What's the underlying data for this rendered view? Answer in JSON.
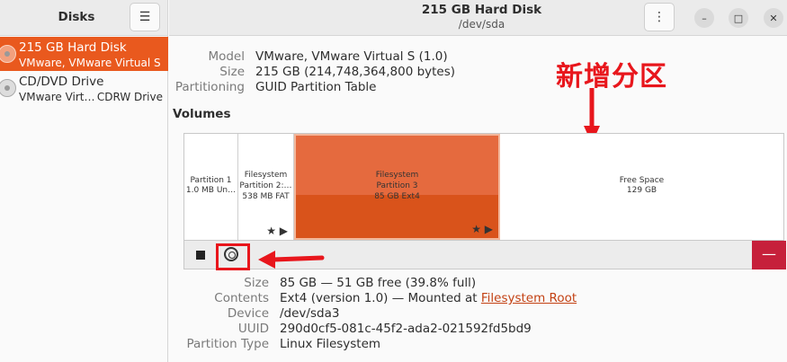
{
  "sidebar": {
    "title": "Disks",
    "menu_icon": "hamburger-icon",
    "disks": [
      {
        "name": "215 GB Hard Disk",
        "sub": "VMware, VMware Virtual S",
        "sub2": ""
      },
      {
        "name": "CD/DVD Drive",
        "sub": "VMware Virt…",
        "sub2": "CDRW Drive"
      }
    ]
  },
  "header": {
    "title": "215 GB Hard Disk",
    "subtitle": "/dev/sda",
    "kebab_icon": "⋮",
    "minimize_icon": "–",
    "maximize_icon": "□",
    "close_icon": "✕"
  },
  "disk_info": {
    "model_label": "Model",
    "model": "VMware, VMware Virtual S (1.0)",
    "size_label": "Size",
    "size": "215 GB (214,748,364,800 bytes)",
    "partitioning_label": "Partitioning",
    "partitioning": "GUID Partition Table"
  },
  "volumes": {
    "title": "Volumes",
    "segments": [
      {
        "l1": "Partition 1",
        "l2": "1.0 MB Un…",
        "l3": ""
      },
      {
        "l1": "Filesystem",
        "l2": "Partition 2:…",
        "l3": "538 MB FAT"
      },
      {
        "l1": "Filesystem",
        "l2": "Partition 3",
        "l3": "85 GB Ext4"
      },
      {
        "l1": "Free Space",
        "l2": "129 GB",
        "l3": ""
      }
    ],
    "seg_tools": "★ ▶"
  },
  "partition_info": {
    "size_label": "Size",
    "size": "85 GB — 51 GB free (39.8% full)",
    "contents_label": "Contents",
    "contents_prefix": "Ext4 (version 1.0) — Mounted at ",
    "contents_link": "Filesystem Root",
    "device_label": "Device",
    "device": "/dev/sda3",
    "uuid_label": "UUID",
    "uuid": "290d0cf5-081c-45f2-ada2-021592fd5bd9",
    "ptype_label": "Partition Type",
    "ptype": "Linux Filesystem"
  },
  "annotation": {
    "text": "新增分区"
  },
  "colors": {
    "accent": "#e9591e",
    "annotation_red": "#e8161c",
    "delete_red": "#c6203b"
  }
}
